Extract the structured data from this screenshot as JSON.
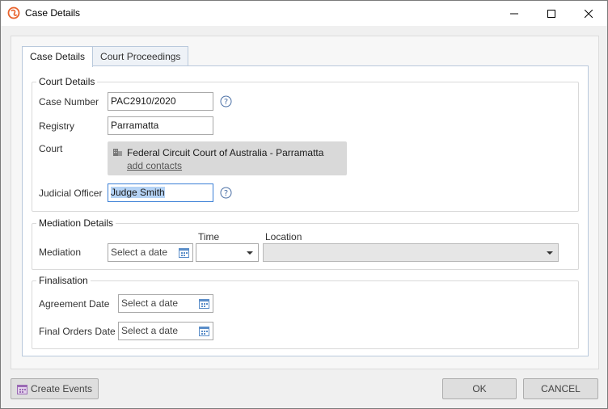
{
  "window": {
    "title": "Case Details",
    "brand_color": "#e8622c"
  },
  "tabs": [
    {
      "label": "Case Details",
      "active": true
    },
    {
      "label": "Court Proceedings",
      "active": false
    }
  ],
  "court_details": {
    "title": "Court Details",
    "case_number": {
      "label": "Case Number",
      "value": "PAC2910/2020"
    },
    "registry": {
      "label": "Registry",
      "value": "Parramatta"
    },
    "court": {
      "label": "Court",
      "name": "Federal Circuit Court of Australia - Parramatta",
      "link": "add contacts"
    },
    "judicial_officer": {
      "label": "Judicial Officer",
      "value": "Judge Smith"
    }
  },
  "mediation_details": {
    "title": "Mediation Details",
    "mediation_label": "Mediation",
    "date_placeholder": "Select a date",
    "time_label": "Time",
    "time_value": "",
    "location_label": "Location",
    "location_value": ""
  },
  "finalisation": {
    "title": "Finalisation",
    "agreement_date": {
      "label": "Agreement Date",
      "placeholder": "Select a date"
    },
    "final_orders_date": {
      "label": "Final Orders Date",
      "placeholder": "Select a date"
    }
  },
  "footer": {
    "create_events": "Create Events",
    "ok": "OK",
    "cancel": "CANCEL"
  }
}
